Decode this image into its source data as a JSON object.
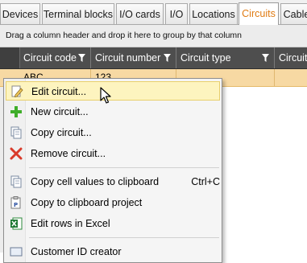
{
  "tabs": [
    {
      "label": "Devices",
      "active": false
    },
    {
      "label": "Terminal blocks",
      "active": false
    },
    {
      "label": "I/O cards",
      "active": false
    },
    {
      "label": "I/O",
      "active": false
    },
    {
      "label": "Locations",
      "active": false
    },
    {
      "label": "Circuits",
      "active": true
    },
    {
      "label": "Cable",
      "active": false
    }
  ],
  "group_bar": {
    "text": "Drag a column header and drop it here to group by that column"
  },
  "columns": [
    "Circuit code",
    "Circuit number",
    "Circuit type",
    "Circuit"
  ],
  "selected_row": {
    "circuit_code": "ABC",
    "circuit_number": "123"
  },
  "context_menu": {
    "items": [
      {
        "label": "Edit circuit...",
        "icon": "edit-icon",
        "shortcut": ""
      },
      {
        "label": "New circuit...",
        "icon": "plus-icon",
        "shortcut": ""
      },
      {
        "label": "Copy circuit...",
        "icon": "copy-icon",
        "shortcut": ""
      },
      {
        "label": "Remove circuit...",
        "icon": "remove-icon",
        "shortcut": ""
      },
      {
        "label": "Copy cell values to clipboard",
        "icon": "clipboard-icon",
        "shortcut": "Ctrl+C"
      },
      {
        "label": "Copy to clipboard project",
        "icon": "clipboard-project-icon",
        "shortcut": ""
      },
      {
        "label": "Edit rows in Excel",
        "icon": "excel-icon",
        "shortcut": ""
      },
      {
        "label": "Customer ID creator",
        "icon": "id-icon",
        "shortcut": ""
      }
    ]
  },
  "colors": {
    "accent": "#e07b12",
    "header_bg": "#4e4e4e",
    "selected_row": "#f7d9a3",
    "menu_highlight": "#fdf4bf"
  }
}
